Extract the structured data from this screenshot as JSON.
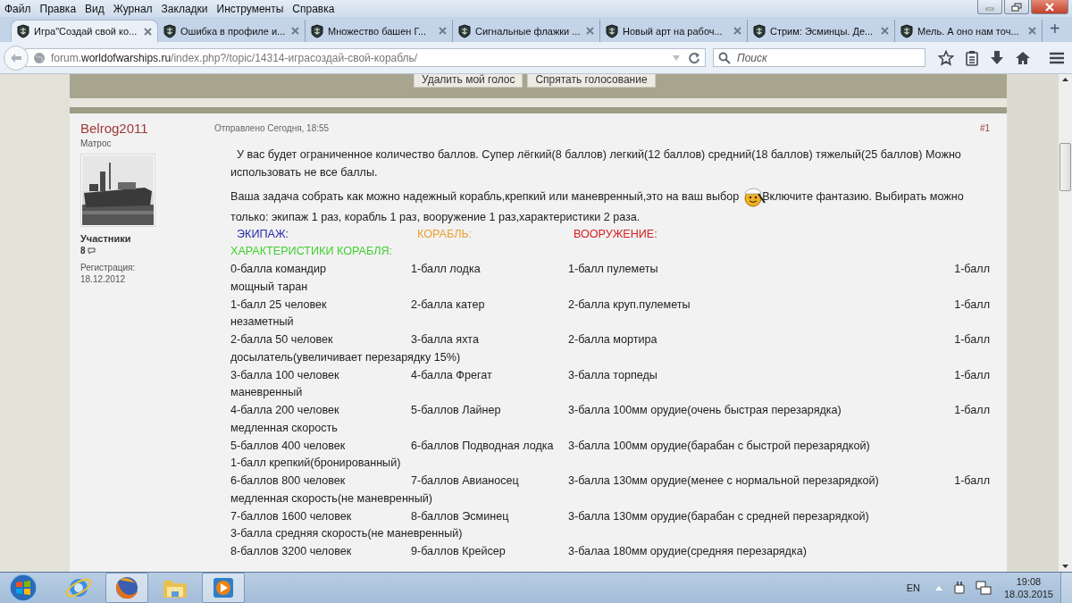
{
  "menu": [
    "Файл",
    "Правка",
    "Вид",
    "Журнал",
    "Закладки",
    "Инструменты",
    "Справка"
  ],
  "tabs": [
    {
      "title": "Игра\"Создай свой ко...",
      "selected": true
    },
    {
      "title": "Ошибка в профиле и...",
      "selected": false
    },
    {
      "title": "Множество башен Г...",
      "selected": false
    },
    {
      "title": "Сигнальные флажки ...",
      "selected": false
    },
    {
      "title": "Новый арт на рабоч...",
      "selected": false
    },
    {
      "title": "Стрим: Эсминцы. Де...",
      "selected": false
    },
    {
      "title": "Мель. А оно нам точ...",
      "selected": false
    }
  ],
  "new_tab": "+",
  "address": "forum.**worldofwarships.ru**/index.php?/topic/14314-играсоздай-свой-корабль/",
  "search": {
    "placeholder": "Поиск"
  },
  "poll_buttons": [
    "Удалить мой голос",
    "Спрятать голосование"
  ],
  "post": {
    "author": "Belrog2011",
    "rank": "Матрос",
    "group": "Участники",
    "posts": "8",
    "reg_label": "Регистрация:",
    "reg_date": "18.12.2012",
    "posted": "Отправлено Сегодня, 18:55",
    "number": "#1",
    "intro": "У вас будет ограниченное количество баллов. Супер лёгкий(8 баллов) легкий(12 баллов) средний(18 баллов) тяжелый(25 баллов) Можно использовать не все баллы.",
    "task_before": "Ваша задача собрать как можно надежный корабль,крепкий или маневренный,это на ваш выбор",
    "task_after": "Включите фантазию. Выбирать можно",
    "task_last_line": "только: экипаж 1 раз, корабль 1 раз, вооружение 1 раз,характеристики 2 раза.",
    "headings": [
      {
        "text": "ЭКИПАЖ:",
        "color": "#2a2aa8"
      },
      {
        "text": "КОРАБЛЬ:",
        "color": "#e8a030"
      },
      {
        "text": "ВООРУЖЕНИЕ:",
        "color": "#d42020"
      }
    ],
    "traits_heading": {
      "text": "ХАРАКТЕРИСТИКИ КОРАБЛЯ:",
      "color": "#40d030"
    },
    "rows": [
      {
        "crew": "0-балла командир",
        "ship": "1-балл лодка",
        "armament": "1-балл пулеметы",
        "trait_points": "1-балл",
        "next_line": "мощный таран"
      },
      {
        "crew": "1-балл 25 человек",
        "ship": "2-балла катер",
        "armament": "2-балла круп.пулеметы",
        "trait_points": "1-балл",
        "next_line": "незаметный"
      },
      {
        "crew": "2-балла 50 человек",
        "ship": "3-балла яхта",
        "armament": "2-балла мортира",
        "trait_points": "1-балл",
        "next_line": "досылатель(увеличивает перезарядку 15%)"
      },
      {
        "crew": "3-балла 100 человек",
        "ship": "4-балла Фрегат",
        "armament": "3-балла торпеды",
        "trait_points": "1-балл",
        "next_line": "маневренный"
      },
      {
        "crew": "4-балла 200 человек",
        "ship": "5-баллов Лайнер",
        "armament": "3-балла 100мм орудие(очень быстрая перезарядка)",
        "trait_points": "1-балл",
        "next_line": "медленная скорость"
      },
      {
        "crew": "5-баллов 400 человек",
        "ship": "6-баллов Подводная лодка",
        "armament": "3-балла 100мм орудие(барабан с быстрой перезарядкой)",
        "next_line": "1-балл крепкий(бронированный)"
      },
      {
        "crew": "6-баллов 800 человек",
        "ship": "7-баллов Авианосец",
        "armament": "3-балла 130мм орудие(менее с нормальной перезарядкой)",
        "trait_points": "1-балл",
        "next_line": "медленная скорость(не маневренный)"
      },
      {
        "crew": "7-баллов 1600 человек",
        "ship": "8-баллов Эсминец",
        "armament": "3-балла 130мм орудие(барабан с средней перезарядкой)",
        "next_line": "3-балла средняя скорость(не маневренный)"
      },
      {
        "crew": "8-баллов 3200 человек",
        "ship": "9-баллов Крейсер",
        "armament": "3-балаа 180мм орудие(средняя перезарядка)"
      }
    ]
  },
  "taskbar": {
    "language": "EN",
    "time": "19:08",
    "date": "18.03.2015"
  }
}
